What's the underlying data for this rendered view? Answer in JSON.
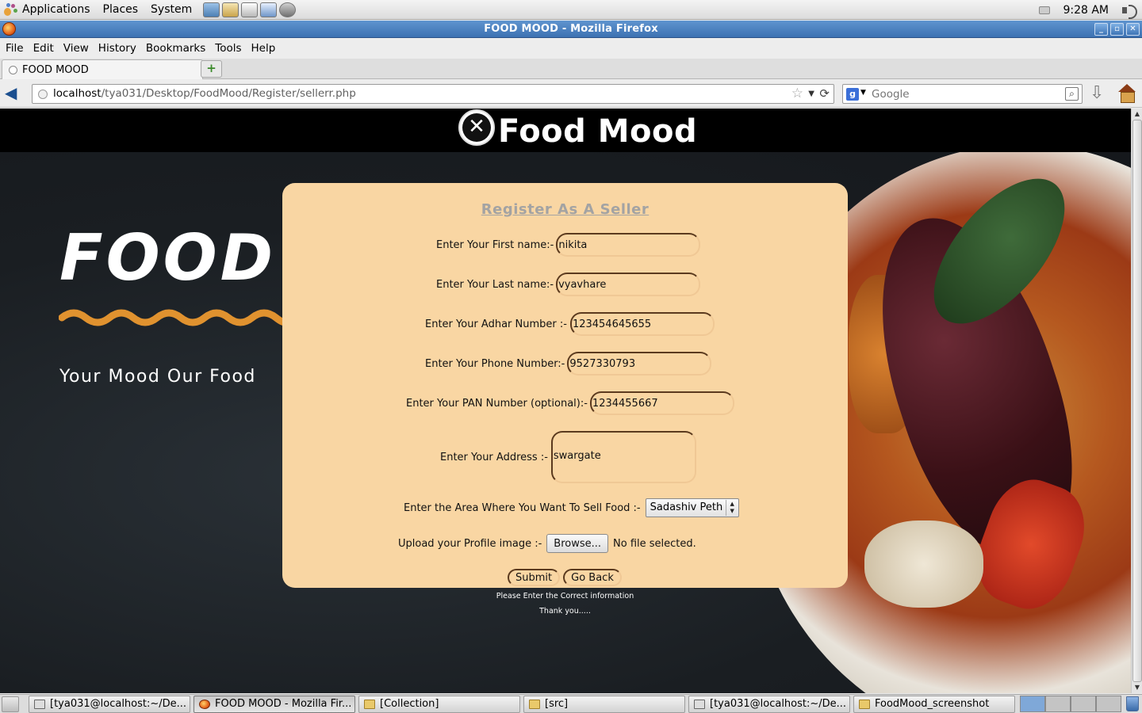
{
  "panel": {
    "menus": [
      "Applications",
      "Places",
      "System"
    ],
    "clock": "9:28 AM"
  },
  "window": {
    "title": "FOOD MOOD - Mozilla Firefox"
  },
  "menubar": {
    "file": "File",
    "edit": "Edit",
    "view": "View",
    "history": "History",
    "bookmarks": "Bookmarks",
    "tools": "Tools",
    "help": "Help"
  },
  "tab": {
    "label": "FOOD MOOD",
    "new_tab": "+"
  },
  "navbar": {
    "url_host": "localhost",
    "url_path": "/tya031/Desktop/FoodMood/Register/sellerr.php",
    "search_placeholder": "Google"
  },
  "site": {
    "header_title": "Food Mood",
    "hero_title": "FOOD MOOD",
    "hero_tagline": "Your Mood Our Food"
  },
  "form": {
    "title": "Register As A Seller",
    "first_name_label": "Enter Your First name:-",
    "first_name_value": "nikita",
    "last_name_label": "Enter Your Last name:-",
    "last_name_value": "vyavhare",
    "adhar_label": "Enter Your Adhar Number :-",
    "adhar_value": "123454645655",
    "phone_label": "Enter Your Phone Number:-",
    "phone_value": "9527330793",
    "pan_label": "Enter Your PAN Number (optional):-",
    "pan_value": "1234455667",
    "address_label": "Enter Your Address :-",
    "address_value": "swargate",
    "area_label": "Enter the Area Where You Want To Sell Food :-",
    "area_selected": "Sadashiv Peth",
    "upload_label": "Upload your Profile image :-",
    "browse_label": "Browse...",
    "file_status": "No file selected.",
    "submit_label": "Submit",
    "goback_label": "Go Back",
    "note_line1": "Please Enter the Correct information",
    "note_line2": "Thank you....."
  },
  "taskbar": {
    "tasks": [
      "[tya031@localhost:~/De...",
      "FOOD MOOD - Mozilla Fir...",
      "[Collection]",
      "[src]",
      "[tya031@localhost:~/De...",
      "FoodMood_screenshot"
    ]
  },
  "colors": {
    "form_bg": "#f9d6a3",
    "accent_wave": "#e0922f",
    "title_bar": "#3d72b2"
  }
}
